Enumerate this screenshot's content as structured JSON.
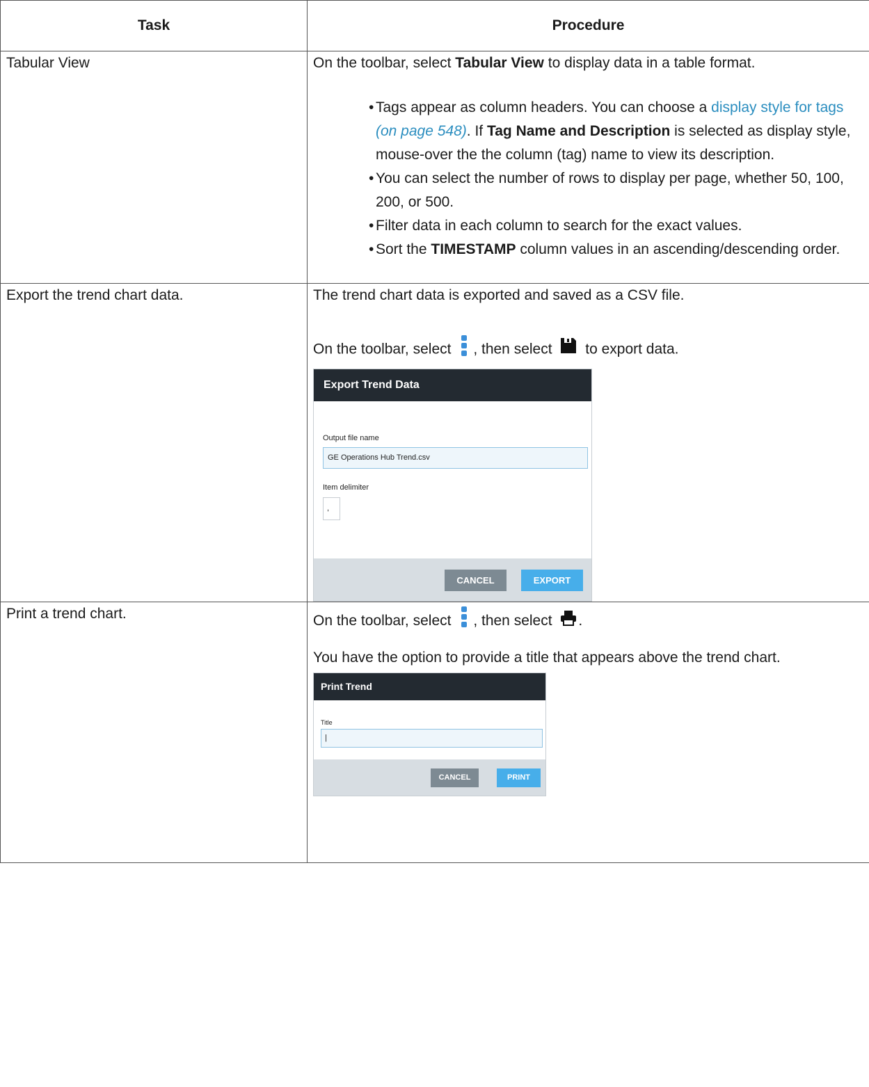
{
  "header": {
    "task": "Task",
    "procedure": "Procedure"
  },
  "rows": {
    "tabular": {
      "task": "Tabular View",
      "intro_pre": "On the toolbar, select ",
      "intro_bold": "Tabular View",
      "intro_post": " to display data in a table format.",
      "bullet1_pre": "Tags appear as column headers. You can choose a ",
      "bullet1_link": "display style for tags",
      "bullet1_link_page": "(on page 548)",
      "bullet1_mid": ". If ",
      "bullet1_bold": "Tag Name and Description",
      "bullet1_post": " is selected as display style, mouse-over the the column (tag) name to view its description.",
      "bullet2": "You can select the number of rows to display per page, whether 50, 100, 200, or 500.",
      "bullet3": "Filter data in each column to search for the exact values.",
      "bullet4_pre": "Sort the ",
      "bullet4_bold": "TIMESTAMP",
      "bullet4_post": " column values in an ascending/descending order."
    },
    "export": {
      "task": "Export the trend chart data.",
      "line1": "The trend chart data is exported and saved as a CSV file.",
      "line2_pre": "On the toolbar, select",
      "line2_mid": ", then select",
      "line2_post": "to export data.",
      "dialog": {
        "title": "Export Trend Data",
        "file_label": "Output file name",
        "file_value": "GE Operations Hub Trend.csv",
        "delim_label": "Item delimiter",
        "delim_value": ",",
        "cancel": "CANCEL",
        "confirm": "EXPORT"
      }
    },
    "print": {
      "task": "Print a trend chart.",
      "line1_pre": "On the toolbar, select",
      "line1_mid": ", then select",
      "line1_post": ".",
      "line2": "You have the option to provide a title that appears above the trend chart.",
      "dialog": {
        "title": "Print Trend",
        "title_label": "Title",
        "title_value": "|",
        "cancel": "CANCEL",
        "confirm": "PRINT"
      }
    }
  },
  "icons": {
    "more": "more-vertical-icon",
    "save": "floppy-disk-icon",
    "print": "printer-icon"
  },
  "colors": {
    "link": "#2a8dbf",
    "dialog_header": "#232a31",
    "primary_button": "#47aeea",
    "cancel_button": "#7d8a93"
  }
}
